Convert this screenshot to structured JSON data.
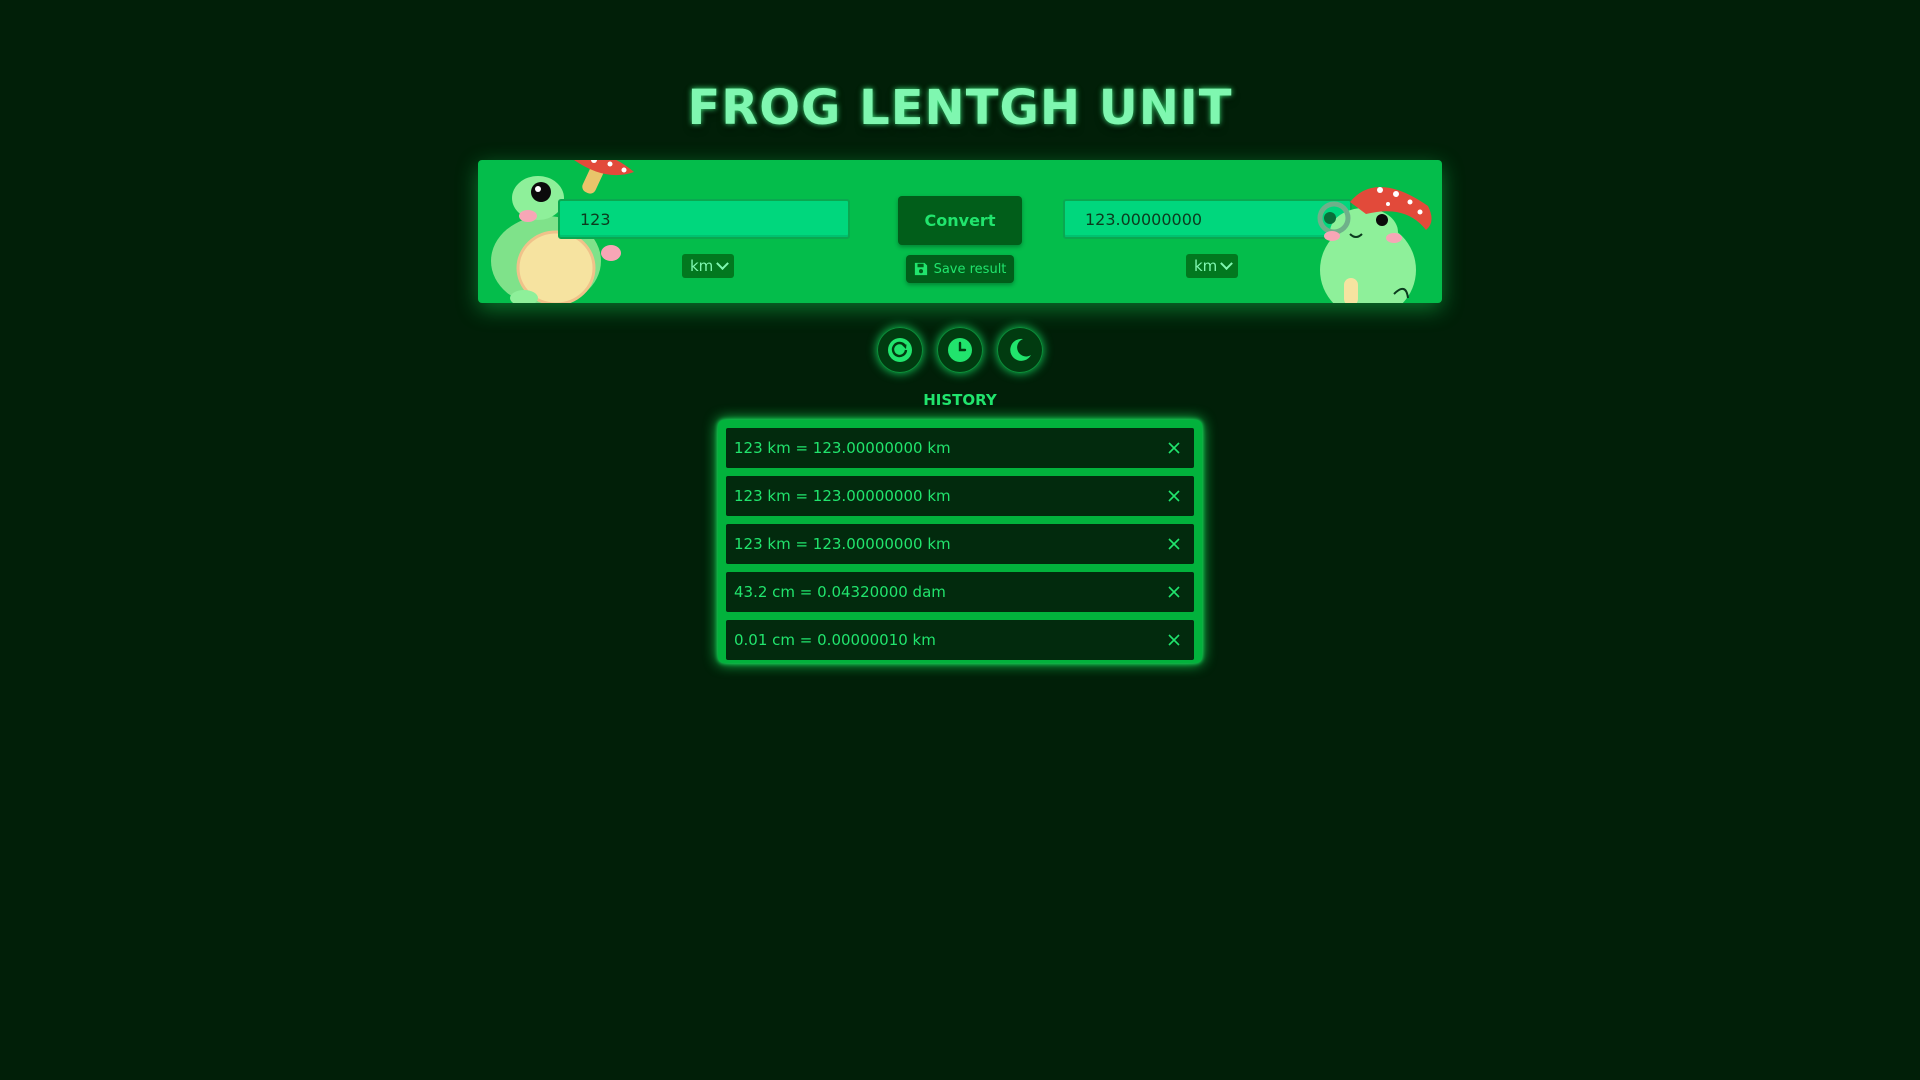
{
  "app": {
    "title": "FROG LENTGH UNIT"
  },
  "converter": {
    "input_value": "123",
    "output_value": "123.00000000",
    "from_unit": "km",
    "to_unit": "km",
    "convert_label": "Convert",
    "save_label": "Save result"
  },
  "toolbar": {
    "icons": [
      "reset-icon",
      "history-icon",
      "moon-icon"
    ]
  },
  "history": {
    "title": "HISTORY",
    "items": [
      "123 km = 123.00000000 km",
      "123 km = 123.00000000 km",
      "123 km = 123.00000000 km",
      "43.2 cm = 0.04320000 dam",
      "0.01 cm = 0.00000010 km"
    ]
  },
  "colors": {
    "background": "#011f08",
    "banner": "#04bd4b",
    "accent": "#21e46d",
    "title": "#7ff7b0"
  }
}
